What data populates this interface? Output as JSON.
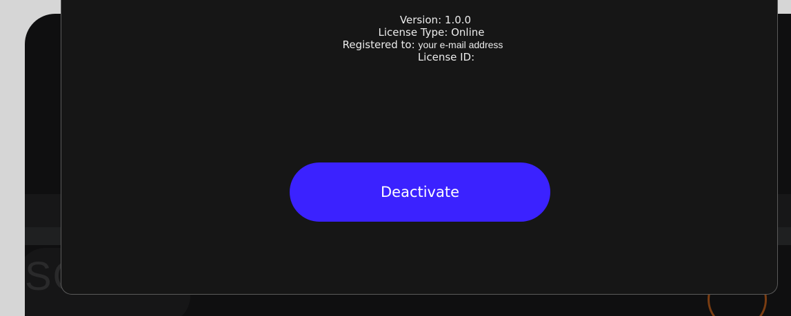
{
  "license": {
    "version_label": "Version:",
    "version_value": "1.0.0",
    "type_label": "License Type:",
    "type_value": "Online",
    "registered_label": "Registered to:",
    "registered_value": "your e-mail address",
    "id_label": "License ID:",
    "id_value": ""
  },
  "actions": {
    "deactivate_label": "Deactivate"
  },
  "background": {
    "partial_text": "SO"
  },
  "colors": {
    "button": "#3b22ff",
    "panel": "#161616",
    "page": "#d6d6d6",
    "knob_ring": "#7a3d12"
  }
}
